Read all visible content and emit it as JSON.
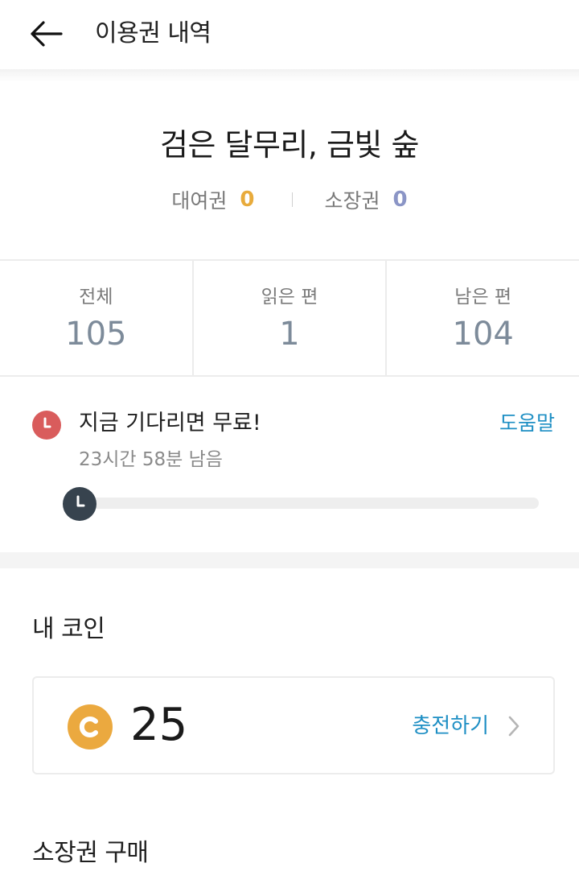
{
  "header": {
    "title": "이용권 내역",
    "back_icon": "back-arrow-icon"
  },
  "series": {
    "title": "검은 달무리, 금빛 숲",
    "rental": {
      "label": "대여권",
      "value": "0",
      "color": "#e8ab3c"
    },
    "owned": {
      "label": "소장권",
      "value": "0",
      "color": "#8b95c6"
    }
  },
  "stats": [
    {
      "label": "전체",
      "value": "105"
    },
    {
      "label": "읽은 편",
      "value": "1"
    },
    {
      "label": "남은 편",
      "value": "104"
    }
  ],
  "wait_free": {
    "title": "지금 기다리면 무료!",
    "help_label": "도움말",
    "remaining": "23시간 58분 남음",
    "progress": 0,
    "clock_icon": "clock-icon"
  },
  "coins": {
    "heading": "내 코인",
    "amount": "25",
    "charge_label": "충전하기",
    "coin_icon": "coin-icon",
    "accent": "#1e8fc4"
  },
  "purchase": {
    "heading": "소장권 구매"
  }
}
